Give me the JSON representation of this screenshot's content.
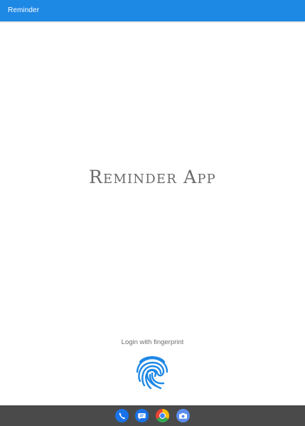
{
  "app_bar": {
    "title": "Reminder"
  },
  "main": {
    "app_name": "Reminder App",
    "login_label": "Login with fingerprint",
    "fingerprint_icon": "fingerprint-icon"
  },
  "taskbar": {
    "icons": [
      "phone-icon",
      "messages-icon",
      "chrome-icon",
      "camera-icon"
    ]
  },
  "colors": {
    "app_bar": "#1e88e5",
    "accent": "#1e88e5",
    "taskbar": "#4a4a4a"
  }
}
